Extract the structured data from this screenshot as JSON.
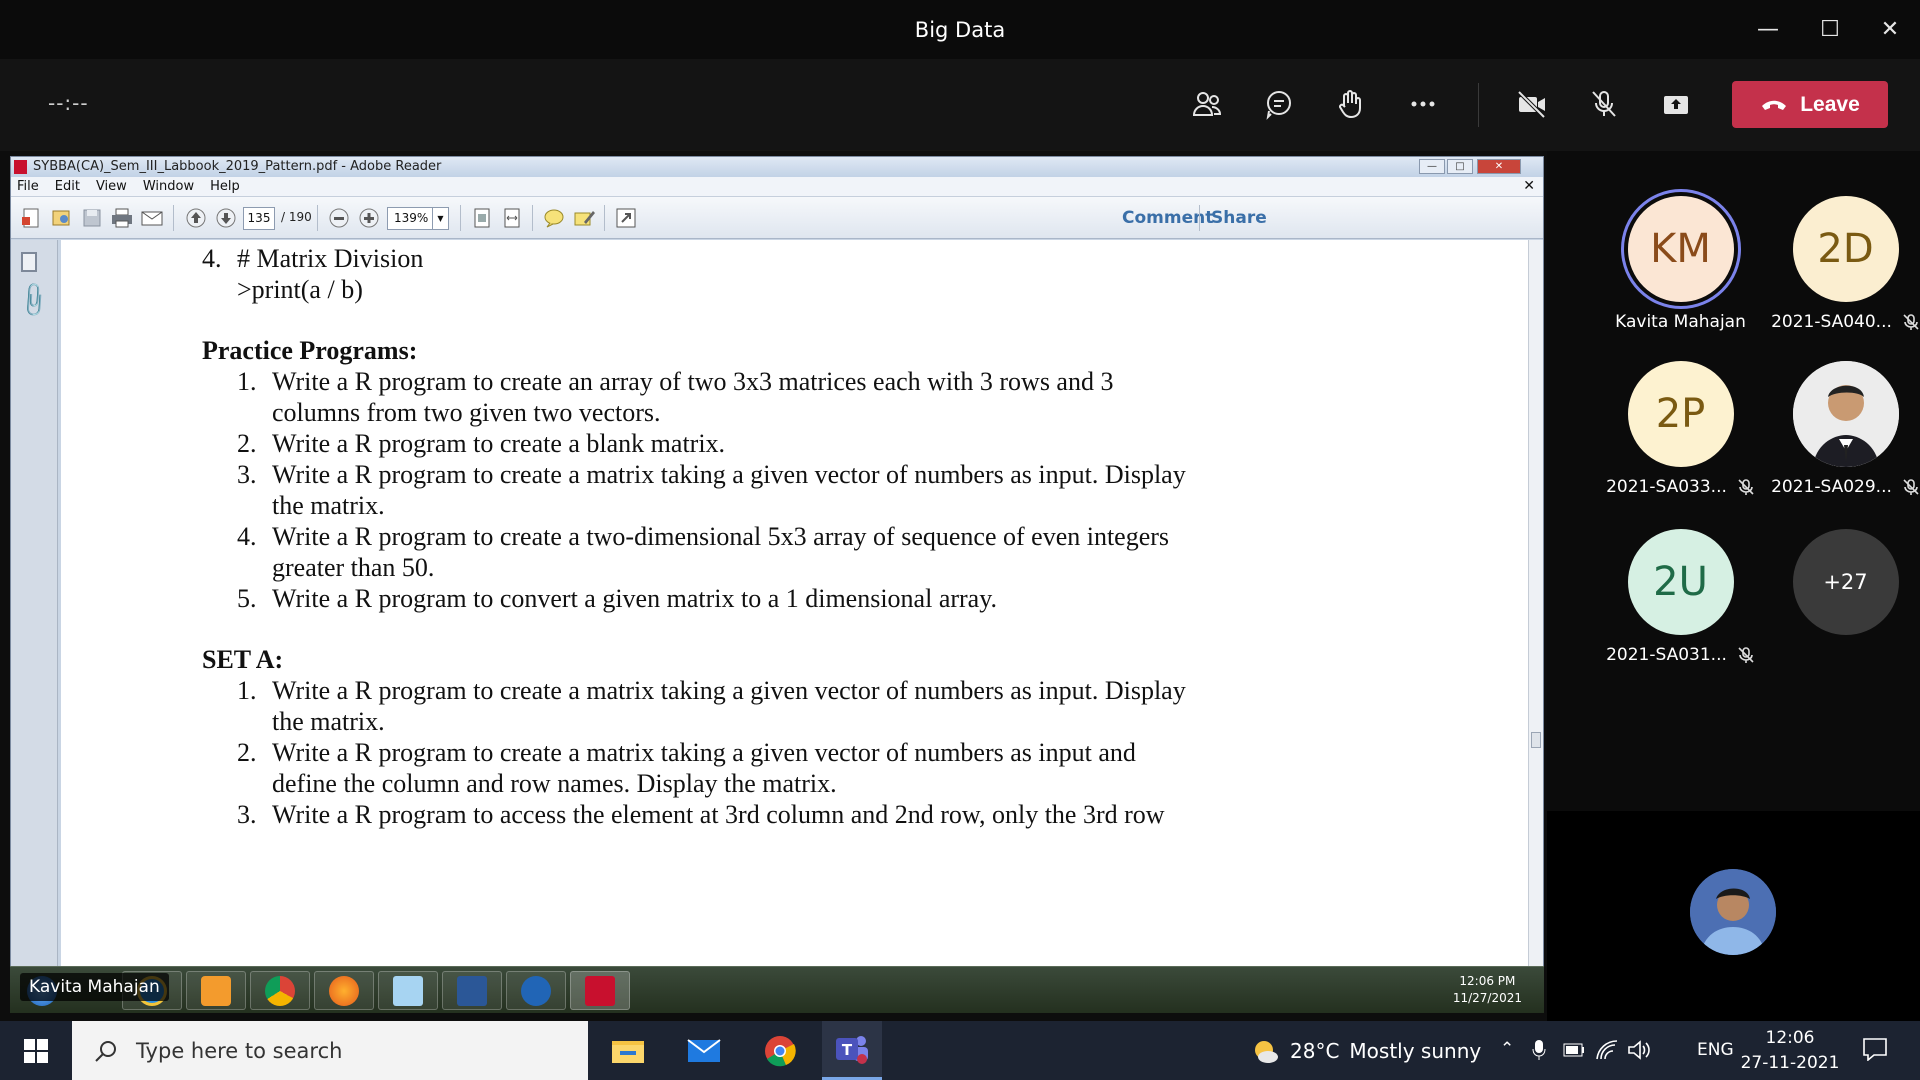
{
  "window": {
    "title": "Big Data"
  },
  "meeting": {
    "timer": "--:--",
    "leave_label": "Leave",
    "toolbar_icons": [
      "people-icon",
      "chat-icon",
      "raise-hand-icon",
      "more-options-icon",
      "camera-off-icon",
      "mic-off-icon",
      "share-tray-icon"
    ]
  },
  "reader": {
    "title": "SYBBA(CA)_Sem_III_Labbook_2019_Pattern.pdf - Adobe Reader",
    "menu": [
      "File",
      "Edit",
      "View",
      "Window",
      "Help"
    ],
    "page_current": "135",
    "page_total": "/ 190",
    "zoom": "139%",
    "comment_label": "Comment",
    "share_label": "Share"
  },
  "doc": {
    "item4_num": "4.",
    "item4_text": "# Matrix Division",
    "item4_code": ">print(a / b)",
    "practice_heading": "Practice Programs:",
    "practice": [
      {
        "num": "1.",
        "lines": [
          "Write a R program to create an array of two 3x3 matrices each with 3 rows and 3",
          "columns from two given two vectors."
        ]
      },
      {
        "num": "2.",
        "lines": [
          "Write a R program to create a blank matrix."
        ]
      },
      {
        "num": "3.",
        "lines": [
          "Write a R program to create a matrix taking a given vector of numbers as input. Display",
          "the matrix."
        ]
      },
      {
        "num": "4.",
        "lines": [
          "Write a R program to create a two-dimensional 5x3 array of sequence of even integers",
          "greater than 50."
        ]
      },
      {
        "num": "5.",
        "lines": [
          "Write a R program to convert a given matrix to a 1 dimensional array."
        ]
      }
    ],
    "seta_heading": "SET A:",
    "seta": [
      {
        "num": "1.",
        "lines": [
          "Write a R program to create a matrix taking a given vector of numbers as input. Display",
          "the matrix."
        ]
      },
      {
        "num": "2.",
        "lines": [
          "Write a R program to create a matrix taking a given vector of numbers as input and",
          "define the column and row names. Display the matrix."
        ]
      },
      {
        "num": "3.",
        "lines": [
          "Write a R program to access the element at 3rd column and 2nd row, only the 3rd row"
        ]
      }
    ]
  },
  "remote_taskbar": {
    "time": "12:06 PM",
    "date": "11/27/2021",
    "presenter": "Kavita Mahajan"
  },
  "participants": [
    {
      "initials": "KM",
      "name": "Kavita Mahajan",
      "muted": false,
      "bg": "#fbe6d4",
      "fg": "#8a4b1a",
      "speaking": true
    },
    {
      "initials": "2D",
      "name": "2021-SA040...",
      "muted": true,
      "bg": "#fbeed0",
      "fg": "#7a5a12",
      "speaking": false
    },
    {
      "initials": "2P",
      "name": "2021-SA033...",
      "muted": true,
      "bg": "#fdf2d0",
      "fg": "#7a5a12",
      "speaking": false
    },
    {
      "initials": "",
      "name": "2021-SA029...",
      "muted": true,
      "bg": "#e9e9e9",
      "fg": "#333",
      "speaking": false
    },
    {
      "initials": "2U",
      "name": "2021-SA031...",
      "muted": true,
      "bg": "#d6f0e3",
      "fg": "#1f6b47",
      "speaking": false
    }
  ],
  "overflow_count": "+27",
  "taskbar": {
    "search_placeholder": "Type here to search",
    "temperature": "28°C",
    "weather": "Mostly sunny",
    "lang": "ENG",
    "time": "12:06",
    "date": "27-11-2021"
  }
}
